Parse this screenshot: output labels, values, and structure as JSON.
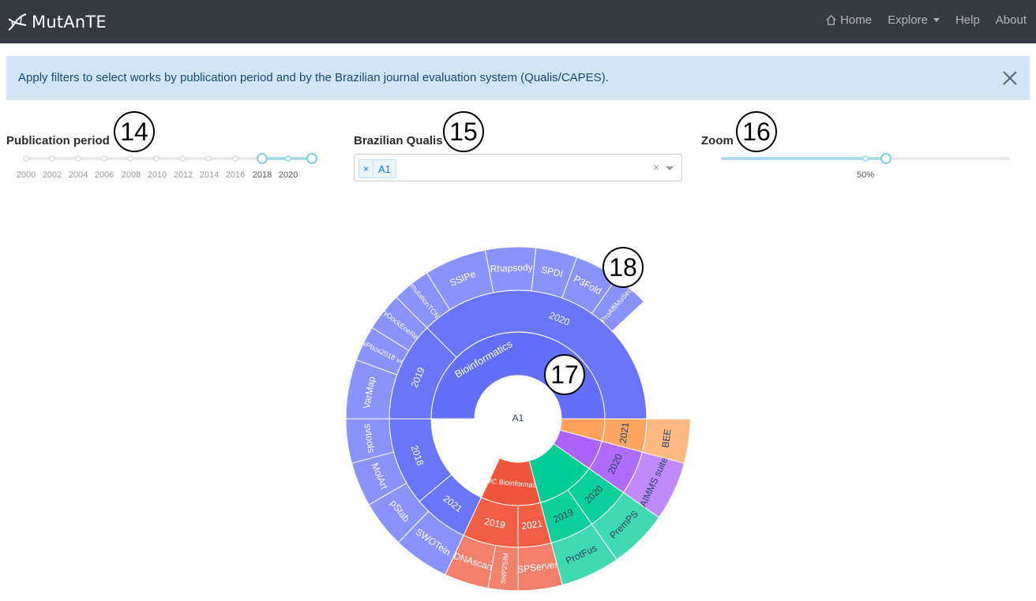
{
  "app": {
    "brand": "MutAnTE"
  },
  "nav": {
    "home": "Home",
    "explore": "Explore",
    "help": "Help",
    "about": "About"
  },
  "alert": {
    "text": "Apply filters to select works by publication period and by the Brazilian journal evaluation system (Qualis/CAPES)."
  },
  "controls": {
    "period": {
      "label": "Publication period",
      "marks": [
        "2000",
        "2002",
        "2004",
        "2006",
        "2008",
        "2010",
        "2012",
        "2014",
        "2016",
        "2018",
        "2020"
      ],
      "range": [
        "2018",
        "2021"
      ]
    },
    "qualis": {
      "label": "Brazilian Qualis",
      "selected": [
        "A1"
      ]
    },
    "zoom": {
      "label": "Zoom",
      "value": "50%"
    }
  },
  "callouts": [
    "14",
    "15",
    "16",
    "17",
    "18"
  ],
  "colors": {
    "navbar": "#343a40",
    "alert_bg": "#d1e5f5",
    "slider_accent": "#a8ddee",
    "bioinformatics": "#636efa",
    "bmc_bioinformatics": "#ef553b",
    "green_journal": "#00cc96",
    "purple_journal": "#ab63fa",
    "orange_journal": "#ffa15a"
  },
  "chart_data": {
    "type": "sunburst",
    "root": "A1",
    "journals": [
      {
        "name": "Bioinformatics",
        "color": "#636efa",
        "years": [
          {
            "year": "2020",
            "tools": [
              "P3Fold",
              "ProAffiMuSeq",
              "Rhapsody",
              "SPDI",
              "SSIPe",
              "mutationTCN",
              "PyDockEneRes",
              "SNPbox2018 v4.0"
            ]
          },
          {
            "year": "2019",
            "tools": [
              "VarMap"
            ]
          },
          {
            "year": "2018",
            "tools": [
              "svtools",
              "MolArt"
            ]
          },
          {
            "year": "2021",
            "tools": [
              "pStab",
              "SWOTein"
            ]
          },
          {
            "year": "2020 ",
            "tools": [
              "HotSpot3D",
              "EvoEF2",
              "AggreBATE-Pred"
            ]
          }
        ]
      },
      {
        "name": "BMC Bioinformatics",
        "color": "#ef553b",
        "years": [
          {
            "year": "2019",
            "tools": [
              "DNAscan",
              "SNP2SIM"
            ]
          },
          {
            "year": "2021",
            "tools": [
              "SPServer"
            ]
          }
        ]
      },
      {
        "name": "",
        "color": "#00cc96",
        "years": [
          {
            "year": "2019",
            "tools": [
              "ProtFus"
            ]
          },
          {
            "year": "2020",
            "tools": [
              "PremPS"
            ]
          }
        ]
      },
      {
        "name": "",
        "color": "#ab63fa",
        "years": [
          {
            "year": "2020",
            "tools": [
              "AIMMS suite"
            ]
          }
        ]
      },
      {
        "name": "",
        "color": "#ffa15a",
        "years": [
          {
            "year": "2021",
            "tools": [
              "BEE"
            ]
          }
        ]
      }
    ]
  }
}
